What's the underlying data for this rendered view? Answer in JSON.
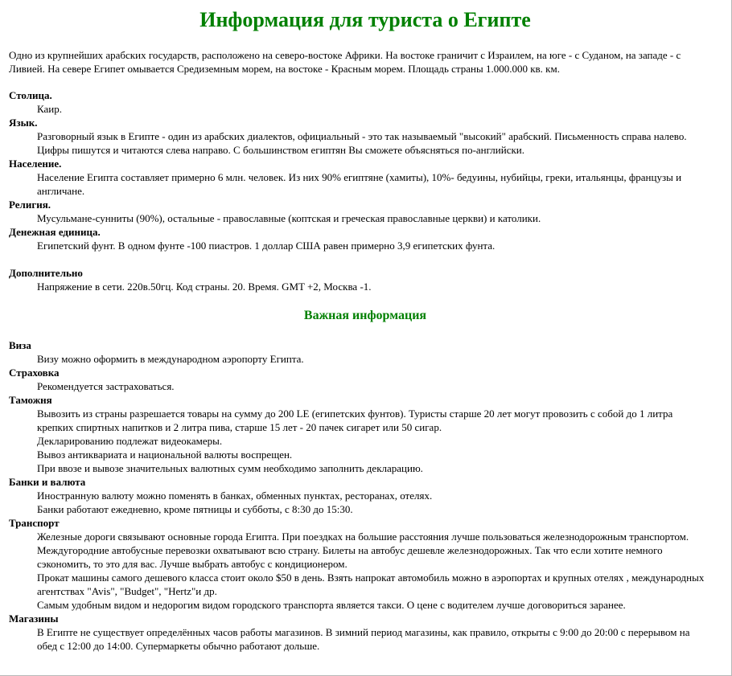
{
  "title": "Информация для туриста о Египте",
  "intro": "Одно из крупнейших арабских государств, расположено на северо-востоке Африки. На востоке граничит с Израилем, на юге - с Суданом, на западе - с Ливией. На севере Египет омывается Средиземным морем, на востоке - Красным морем. Площадь страны 1.000.000 кв. км.",
  "general": [
    {
      "term": "Столица.",
      "lines": [
        "Каир."
      ]
    },
    {
      "term": "Язык.",
      "lines": [
        "Разговорный язык в Египте - один из арабских диалектов, официальный - это так называемый \"высокий\" арабский. Письменность справа налево. Цифры пишутся и читаются слева направо. С большинством египтян Вы сможете объясняться по-английски."
      ]
    },
    {
      "term": "Население.",
      "lines": [
        "Население Египта составляет примерно 6 млн. человек. Из них 90% египтяне (хамиты), 10%- бедуины, нубийцы, греки, итальянцы, французы и англичане."
      ]
    },
    {
      "term": "Религия.",
      "lines": [
        "Мусульмане-сунниты (90%), остальные - православные (коптская и греческая православные церкви) и католики."
      ]
    },
    {
      "term": "Денежная единица.",
      "lines": [
        "Египетский фунт. В одном фунте -100 пиастров. 1 доллар США равен примерно 3,9 египетских фунта."
      ]
    },
    {
      "term": "Дополнительно",
      "lines": [
        "Напряжение в сети. 220в.50гц. Код страны. 20. Время. GMT +2, Москва -1."
      ]
    }
  ],
  "important_heading": "Важная информация",
  "important": [
    {
      "term": "Виза",
      "lines": [
        "Визу можно оформить в международном аэропорту Египта."
      ]
    },
    {
      "term": "Страховка",
      "lines": [
        "Рекомендуется застраховаться."
      ]
    },
    {
      "term": "Таможня",
      "lines": [
        "Вывозить из страны разрешается товары на сумму до 200 LE (египетских фунтов). Туристы старше 20 лет могут провозить с собой до 1 литра крепких спиртных напитков и 2 литра пива, старше 15 лет - 20 пачек сигарет или 50 сигар.",
        "Декларированию подлежат видеокамеры.",
        "Вывоз антиквариата и национальной валюты воспрещен.",
        "При ввозе и вывозе значительных валютных сумм необходимо заполнить декларацию."
      ]
    },
    {
      "term": "Банки и валюта",
      "lines": [
        "Иностранную валюту можно поменять в банках, обменных пунктах, ресторанах, отелях.",
        "Банки работают ежедневно, кроме пятницы и субботы, с 8:30 до 15:30."
      ]
    },
    {
      "term": "Транспорт",
      "lines": [
        "Железные дороги связывают основные города Египта. При поездках на большие расстояния лучше пользоваться железнодорожным транспортом.",
        "Междугородние автобусные перевозки охватывают всю страну. Билеты на автобус дешевле железнодорожных. Так что если хотите немного сэкономить, то это для вас. Лучше выбрать автобус с кондиционером.",
        "Прокат машины самого дешевого класса стоит около $50 в день. Взять напрокат автомобиль можно в аэропортах и крупных отелях , международных агентствах \"Avis\", \"Budget\", \"Hertz\"и др.",
        "Самым удобным видом и недорогим видом городского транспорта является такси. О цене с водителем лучше договориться заранее."
      ]
    },
    {
      "term": "Магазины",
      "lines": [
        "В Египте не существует определённых часов работы магазинов. В зимний период магазины, как правило, открыты с 9:00 до 20:00 с перерывом на обед с 12:00 до 14:00. Супермаркеты обычно работают дольше."
      ]
    }
  ],
  "accent_color": "#008000"
}
